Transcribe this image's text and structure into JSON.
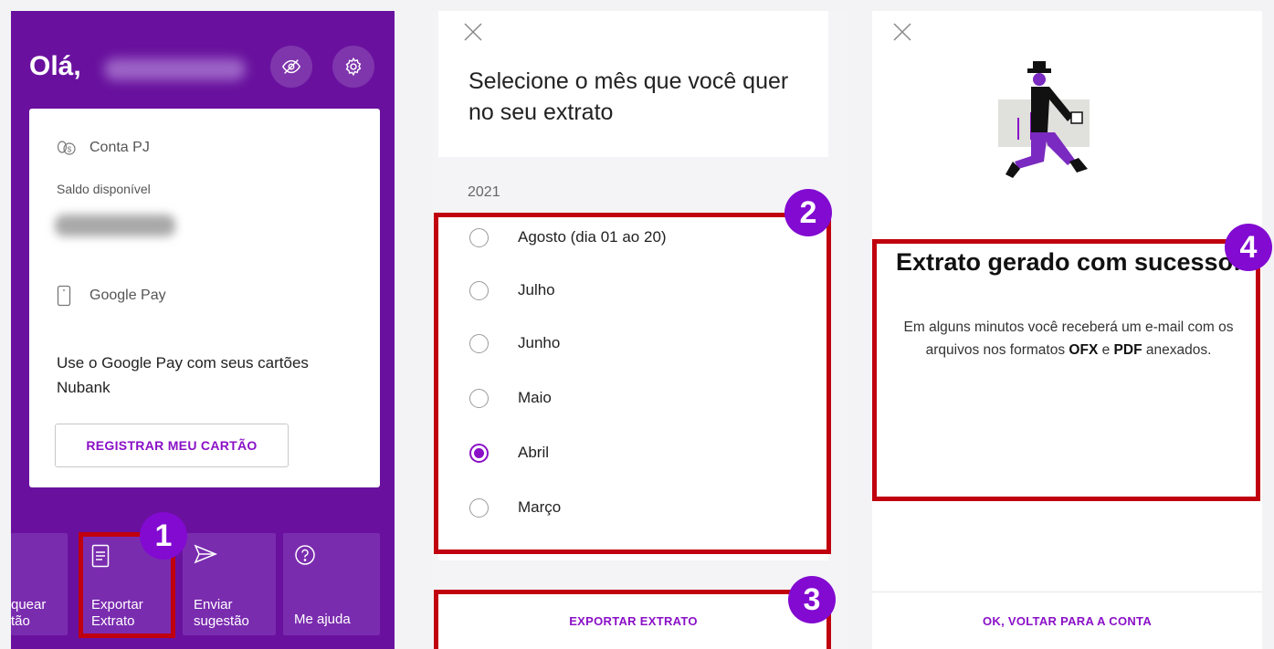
{
  "panel1": {
    "greeting": "Olá,",
    "icons": {
      "hide": "eye-off-icon",
      "settings": "gear-icon"
    },
    "account_card": {
      "icon": "coin-icon",
      "title": "Conta PJ",
      "subtitle": "Saldo disponível"
    },
    "google_pay_card": {
      "icon": "phone-icon",
      "title": "Google Pay",
      "description": "Use o Google Pay com seus cartões Nubank",
      "button": "REGISTRAR MEU CARTÃO"
    },
    "quick_actions": [
      {
        "label": "quear\ntão",
        "icon": ""
      },
      {
        "label": "Exportar\nExtrato",
        "icon": "document-icon"
      },
      {
        "label": "Enviar\nsugestão",
        "icon": "send-icon"
      },
      {
        "label": "Me ajuda",
        "icon": "help-icon"
      }
    ]
  },
  "panel2": {
    "title": "Selecione o mês que você quer no seu extrato",
    "year": "2021",
    "options": [
      {
        "label": "Agosto (dia 01 ao 20)",
        "selected": false
      },
      {
        "label": "Julho",
        "selected": false
      },
      {
        "label": "Junho",
        "selected": false
      },
      {
        "label": "Maio",
        "selected": false
      },
      {
        "label": "Abril",
        "selected": true
      },
      {
        "label": "Março",
        "selected": false
      }
    ],
    "button": "EXPORTAR EXTRATO"
  },
  "panel3": {
    "title": "Extrato gerado com sucesso!",
    "message_part1": "Em alguns minutos você receberá um e-mail com os arquivos nos formatos",
    "format1": "OFX",
    "conj": "e",
    "format2": "PDF",
    "message_part2": "anexados.",
    "button": "OK, VOLTAR PARA A CONTA"
  },
  "annotations": {
    "badges": [
      "1",
      "2",
      "3",
      "4"
    ],
    "highlight_color": "#c0000e",
    "badge_color": "#820ad1"
  },
  "colors": {
    "brand_purple": "#69119e",
    "accent": "#8a10c7"
  }
}
